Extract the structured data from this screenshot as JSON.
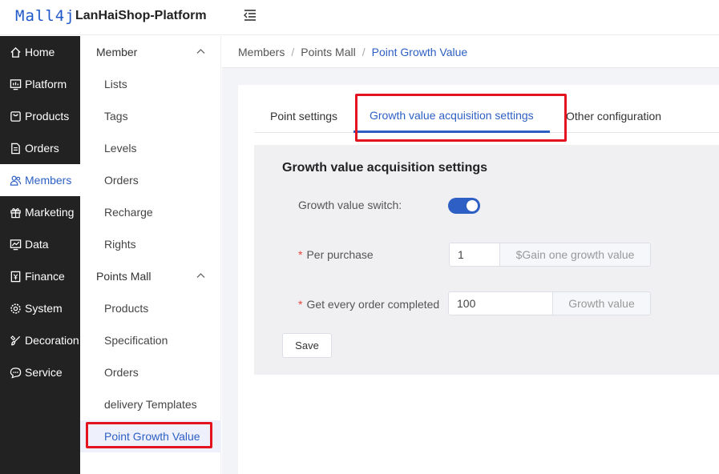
{
  "header": {
    "logo": "Mall4j",
    "title": "LanHaiShop-Platform",
    "collapse_icon": "menu-fold-icon"
  },
  "sidebar": {
    "items": [
      {
        "label": "Home",
        "icon": "home-icon"
      },
      {
        "label": "Platform",
        "icon": "platform-icon"
      },
      {
        "label": "Products",
        "icon": "bag-icon"
      },
      {
        "label": "Orders",
        "icon": "document-icon"
      },
      {
        "label": "Members",
        "icon": "users-icon",
        "active": true
      },
      {
        "label": "Marketing",
        "icon": "gift-icon"
      },
      {
        "label": "Data",
        "icon": "chart-icon"
      },
      {
        "label": "Finance",
        "icon": "finance-icon"
      },
      {
        "label": "System",
        "icon": "gear-icon"
      },
      {
        "label": "Decoration",
        "icon": "brush-icon"
      },
      {
        "label": "Service",
        "icon": "chat-icon"
      }
    ]
  },
  "subsidebar": {
    "groups": [
      {
        "label": "Member",
        "items": [
          "Lists",
          "Tags",
          "Levels",
          "Orders",
          "Recharge",
          "Rights"
        ]
      },
      {
        "label": "Points Mall",
        "items": [
          "Products",
          "Specification",
          "Orders",
          "delivery Templates",
          "Point Growth Value"
        ]
      }
    ],
    "active_item": "Point Growth Value"
  },
  "breadcrumb": [
    "Members",
    "Points Mall",
    "Point Growth Value"
  ],
  "tabs": [
    {
      "label": "Point settings"
    },
    {
      "label": "Growth value acquisition settings",
      "active": true
    },
    {
      "label": "Other configuration"
    }
  ],
  "form": {
    "title": "Growth value acquisition settings",
    "switch_label": "Growth value switch:",
    "switch_on": true,
    "per_purchase_label": "Per purchase",
    "per_purchase_value": "1",
    "per_purchase_suffix": "$Gain one growth value",
    "order_label": "Get every order completed",
    "order_value": "100",
    "order_suffix": "Growth value",
    "save_label": "Save"
  },
  "colors": {
    "accent": "#2d5fc4",
    "sidebar_bg": "#222222",
    "highlight_box": "#e3131f",
    "required": "#e8453c"
  }
}
